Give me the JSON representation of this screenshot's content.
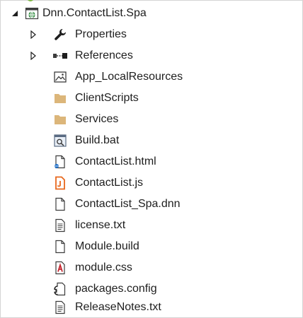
{
  "solution_explorer": {
    "project": {
      "label": "Dnn.ContactList.Spa",
      "expanded": true,
      "icon": "web-project-icon"
    },
    "items": [
      {
        "label": "Properties",
        "icon": "wrench-icon",
        "expandable": true
      },
      {
        "label": "References",
        "icon": "references-icon",
        "expandable": true
      },
      {
        "label": "App_LocalResources",
        "icon": "image-folder-icon",
        "expandable": false
      },
      {
        "label": "ClientScripts",
        "icon": "folder-icon",
        "expandable": false
      },
      {
        "label": "Services",
        "icon": "folder-icon",
        "expandable": false
      },
      {
        "label": "Build.bat",
        "icon": "batch-file-icon",
        "expandable": false
      },
      {
        "label": "ContactList.html",
        "icon": "html-file-icon",
        "expandable": false
      },
      {
        "label": "ContactList.js",
        "icon": "js-file-icon",
        "expandable": false
      },
      {
        "label": "ContactList_Spa.dnn",
        "icon": "blank-file-icon",
        "expandable": false
      },
      {
        "label": "license.txt",
        "icon": "text-file-icon",
        "expandable": false
      },
      {
        "label": "Module.build",
        "icon": "blank-file-icon",
        "expandable": false
      },
      {
        "label": "module.css",
        "icon": "css-file-icon",
        "expandable": false
      },
      {
        "label": "packages.config",
        "icon": "config-file-icon",
        "expandable": false
      },
      {
        "label": "ReleaseNotes.txt",
        "icon": "text-file-icon",
        "expandable": false
      }
    ],
    "colors": {
      "folder": "#dcb67a",
      "js": "#e8681d",
      "css": "#c4262e",
      "html_dot": "#1e6fc9",
      "project_globe": "#2f8a3e",
      "text": "#1e1e1e",
      "icon_dark": "#3c3c3c"
    }
  }
}
